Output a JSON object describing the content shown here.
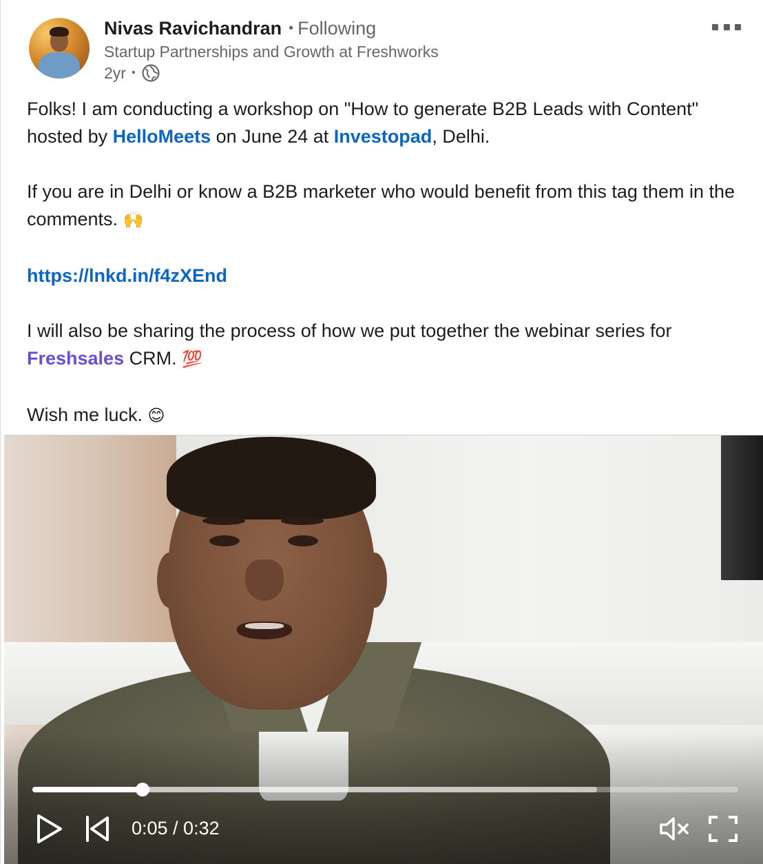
{
  "author": {
    "name": "Nivas Ravichandran",
    "separator": "•",
    "follow_status": "Following",
    "headline": "Startup Partnerships and Growth at Freshworks",
    "time_ago": "2yr",
    "meta_separator": "•",
    "visibility_icon": "globe-icon"
  },
  "menu": {
    "icon": "more-horizontal-icon"
  },
  "post": {
    "p1_a": "Folks! I am conducting a workshop on \"How to generate B2B Leads with Content\" hosted by ",
    "p1_mention1": "HelloMeets",
    "p1_b": " on June 24 at ",
    "p1_mention2": "Investopad",
    "p1_c": ", Delhi.",
    "p2": "If you are in Delhi or know a B2B marketer who would benefit from this tag them in the comments. ",
    "p2_emoji": "🙌",
    "link": "https://lnkd.in/f4zXEnd",
    "p4_a": "I will also be sharing the process of how we put together the webinar series for ",
    "p4_mention": "Freshsales",
    "p4_b": " CRM. ",
    "p4_emoji": "💯",
    "p5": "Wish me luck. ",
    "p5_emoji": "😊"
  },
  "video": {
    "current_time": "0:05",
    "duration": "0:32",
    "time_display": "0:05 / 0:32",
    "progress_fraction": 0.156,
    "buffered_fraction": 0.8,
    "controls": {
      "play_icon": "play-icon",
      "skip_back_icon": "skip-back-icon",
      "mute_icon": "volume-muted-icon",
      "fullscreen_icon": "fullscreen-icon"
    }
  },
  "colors": {
    "link_blue": "#0a66c2",
    "mention_purple": "#6a4fd4",
    "text_primary": "#1d1d1d",
    "text_secondary": "#666666"
  }
}
